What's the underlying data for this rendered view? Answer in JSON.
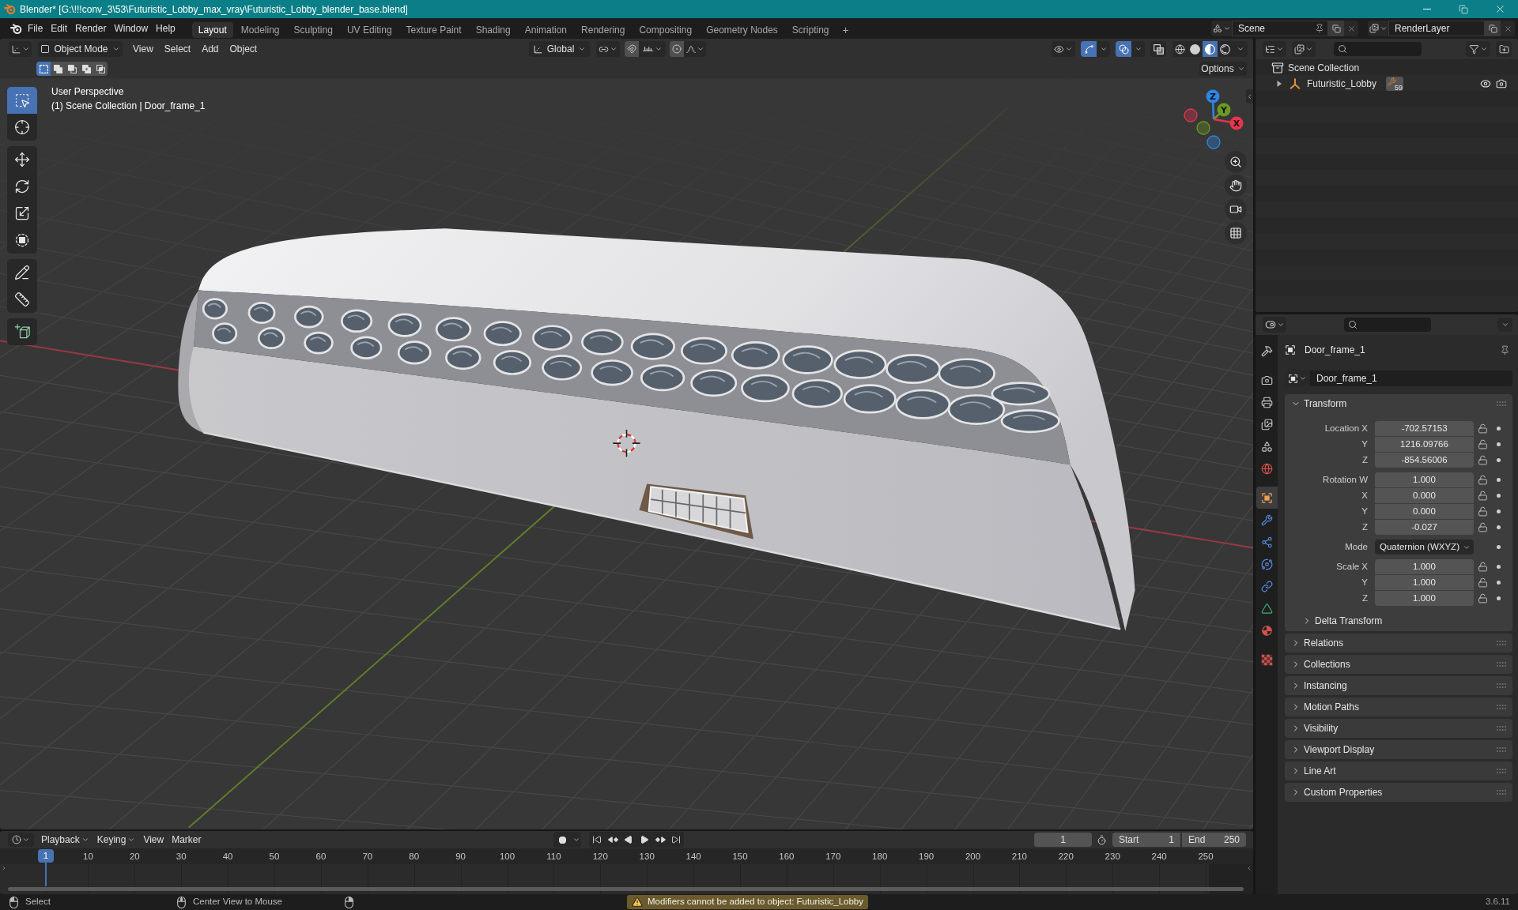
{
  "window": {
    "title": "Blender* [G:\\!!!conv_3\\53\\Futuristic_Lobby_max_vray\\Futuristic_Lobby_blender_base.blend]"
  },
  "menu": [
    "File",
    "Edit",
    "Render",
    "Window",
    "Help"
  ],
  "workspace_tabs": [
    {
      "label": "Layout",
      "selected": true
    },
    {
      "label": "Modeling",
      "selected": false
    },
    {
      "label": "Sculpting",
      "selected": false
    },
    {
      "label": "UV Editing",
      "selected": false
    },
    {
      "label": "Texture Paint",
      "selected": false
    },
    {
      "label": "Shading",
      "selected": false
    },
    {
      "label": "Animation",
      "selected": false
    },
    {
      "label": "Rendering",
      "selected": false
    },
    {
      "label": "Compositing",
      "selected": false
    },
    {
      "label": "Geometry Nodes",
      "selected": false
    },
    {
      "label": "Scripting",
      "selected": false
    }
  ],
  "add_workspace": "+",
  "scene": {
    "name": "Scene"
  },
  "view_layer": {
    "name": "RenderLayer"
  },
  "viewport": {
    "mode": "Object Mode",
    "menus": [
      "View",
      "Select",
      "Add",
      "Object"
    ],
    "orientation": "Global",
    "toggles": [
      {
        "kind": "gizmos",
        "on": true
      },
      {
        "kind": "overlays",
        "on": true
      },
      {
        "kind": "xray",
        "on": false
      }
    ],
    "shading": [
      {
        "kind": "wireframe",
        "selected": false
      },
      {
        "kind": "solid",
        "selected": false
      },
      {
        "kind": "material",
        "selected": true
      },
      {
        "kind": "rendered",
        "selected": false
      }
    ],
    "select_modes": [
      {
        "kind": "set",
        "selected": true
      },
      {
        "kind": "extend",
        "selected": false
      },
      {
        "kind": "subtract",
        "selected": false
      },
      {
        "kind": "difference",
        "selected": false
      },
      {
        "kind": "intersect",
        "selected": false
      }
    ],
    "options": "Options",
    "toolbar": [
      {
        "tools": [
          {
            "kind": "select_box",
            "selected": true
          },
          {
            "kind": "cursor",
            "selected": false
          }
        ]
      },
      {
        "tools": [
          {
            "kind": "move",
            "selected": false
          },
          {
            "kind": "rotate",
            "selected": false
          },
          {
            "kind": "scale",
            "selected": false
          },
          {
            "kind": "transform",
            "selected": false
          }
        ]
      },
      {
        "tools": [
          {
            "kind": "annotate",
            "selected": false
          },
          {
            "kind": "measure",
            "selected": false
          }
        ]
      },
      {
        "tools": [
          {
            "kind": "add_cube",
            "selected": false
          }
        ]
      }
    ],
    "info": [
      "User Perspective",
      "(1) Scene Collection | Door_frame_1"
    ],
    "axes": [
      {
        "label": "Z",
        "color": "#2f86e4"
      },
      {
        "label": "Y",
        "color": "#6b9a22"
      },
      {
        "label": "X",
        "color": "#e8344d"
      }
    ]
  },
  "outliner": {
    "rows": [
      {
        "kind": "collection",
        "label": "Scene Collection",
        "children": [
          {
            "kind": "empty",
            "label": "Futuristic_Lobby",
            "expanded": false,
            "modifiers": "59"
          }
        ]
      }
    ]
  },
  "properties": {
    "tab_groups": [
      {
        "tabs": [
          {
            "kind": "tool",
            "selected": false
          }
        ]
      },
      {
        "tabs": [
          {
            "kind": "render",
            "selected": false
          },
          {
            "kind": "output",
            "selected": false
          },
          {
            "kind": "view_layer",
            "selected": false
          },
          {
            "kind": "scene",
            "selected": false
          },
          {
            "kind": "world",
            "selected": false
          }
        ]
      },
      {
        "tabs": [
          {
            "kind": "object",
            "selected": true
          },
          {
            "kind": "modifiers",
            "selected": false
          },
          {
            "kind": "particles",
            "selected": false
          },
          {
            "kind": "physics",
            "selected": false
          },
          {
            "kind": "constraints",
            "selected": false
          },
          {
            "kind": "data",
            "selected": false
          },
          {
            "kind": "material",
            "selected": false
          }
        ]
      },
      {
        "tabs": [
          {
            "kind": "texture",
            "selected": false
          }
        ]
      }
    ],
    "object_name": "Door_frame_1",
    "datablock": "Door_frame_1",
    "panels": [
      {
        "title": "Transform",
        "expanded": true,
        "groups": [
          {
            "rows": [
              {
                "kind": "number",
                "label": "Location X",
                "value": "-702.57153"
              },
              {
                "kind": "number",
                "label": "Y",
                "value": "1216.09766"
              },
              {
                "kind": "number",
                "label": "Z",
                "value": "-854.56006"
              }
            ]
          },
          {
            "rows": [
              {
                "kind": "number",
                "label": "Rotation W",
                "value": "1.000"
              },
              {
                "kind": "number",
                "label": "X",
                "value": "0.000"
              },
              {
                "kind": "number",
                "label": "Y",
                "value": "0.000"
              },
              {
                "kind": "number",
                "label": "Z",
                "value": "-0.027"
              }
            ]
          },
          {
            "rows": [
              {
                "kind": "dropdown",
                "label": "Mode",
                "value": "Quaternion (WXYZ)"
              }
            ]
          },
          {
            "rows": [
              {
                "kind": "number",
                "label": "Scale X",
                "value": "1.000"
              },
              {
                "kind": "number",
                "label": "Y",
                "value": "1.000"
              },
              {
                "kind": "number",
                "label": "Z",
                "value": "1.000"
              }
            ]
          }
        ],
        "subpanels": [
          {
            "title": "Delta Transform",
            "expanded": false
          }
        ]
      },
      {
        "title": "Relations",
        "expanded": false
      },
      {
        "title": "Collections",
        "expanded": false
      },
      {
        "title": "Instancing",
        "expanded": false
      },
      {
        "title": "Motion Paths",
        "expanded": false
      },
      {
        "title": "Visibility",
        "expanded": false
      },
      {
        "title": "Viewport Display",
        "expanded": false
      },
      {
        "title": "Line Art",
        "expanded": false
      },
      {
        "title": "Custom Properties",
        "expanded": false
      }
    ]
  },
  "timeline": {
    "menus": [
      {
        "kind": "dropdown",
        "label": "Playback"
      },
      {
        "kind": "dropdown",
        "label": "Keying"
      },
      {
        "kind": "menu",
        "label": "View"
      },
      {
        "kind": "menu",
        "label": "Marker"
      }
    ],
    "current_frame": "1",
    "start": {
      "label": "Start",
      "value": "1"
    },
    "end": {
      "label": "End",
      "value": "250"
    },
    "ruler": [
      {
        "label": "1",
        "selected": true
      },
      {
        "label": "10",
        "selected": false
      },
      {
        "label": "20",
        "selected": false
      },
      {
        "label": "30",
        "selected": false
      },
      {
        "label": "40",
        "selected": false
      },
      {
        "label": "50",
        "selected": false
      },
      {
        "label": "60",
        "selected": false
      },
      {
        "label": "70",
        "selected": false
      },
      {
        "label": "80",
        "selected": false
      },
      {
        "label": "90",
        "selected": false
      },
      {
        "label": "100",
        "selected": false
      },
      {
        "label": "110",
        "selected": false
      },
      {
        "label": "120",
        "selected": false
      },
      {
        "label": "130",
        "selected": false
      },
      {
        "label": "140",
        "selected": false
      },
      {
        "label": "150",
        "selected": false
      },
      {
        "label": "160",
        "selected": false
      },
      {
        "label": "170",
        "selected": false
      },
      {
        "label": "180",
        "selected": false
      },
      {
        "label": "190",
        "selected": false
      },
      {
        "label": "200",
        "selected": false
      },
      {
        "label": "210",
        "selected": false
      },
      {
        "label": "220",
        "selected": false
      },
      {
        "label": "230",
        "selected": false
      },
      {
        "label": "240",
        "selected": false
      },
      {
        "label": "250",
        "selected": false
      }
    ]
  },
  "status_bar": {
    "hints": [
      {
        "kind": "mouse_left",
        "label": "Select"
      },
      {
        "kind": "mouse_middle",
        "label": "Center View to Mouse"
      },
      {
        "kind": "mouse_right"
      }
    ],
    "message": {
      "kind": "warning",
      "text": "Modifiers cannot be added to object: Futuristic_Lobby"
    },
    "version": "3.6.11"
  }
}
